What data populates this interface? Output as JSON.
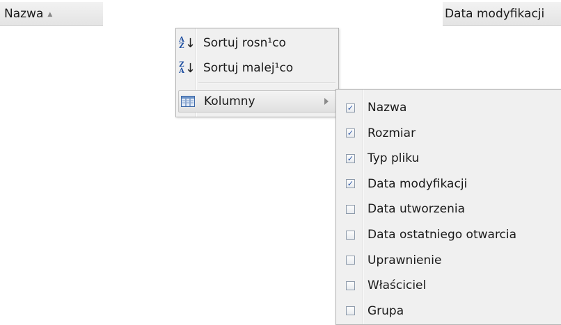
{
  "header": {
    "col_name": "Nazwa",
    "col_modified": "Data modyfikacji",
    "sort_indicator": "▲"
  },
  "menu": {
    "sort_asc": "Sortuj rosn¹co",
    "sort_desc": "Sortuj malej¹co",
    "columns": "Kolumny",
    "sort_asc_icon_top": "A",
    "sort_asc_icon_bottom": "Z",
    "sort_desc_icon_top": "Z",
    "sort_desc_icon_bottom": "A"
  },
  "columns_submenu": [
    {
      "label": "Nazwa",
      "checked": true
    },
    {
      "label": "Rozmiar",
      "checked": true
    },
    {
      "label": "Typ pliku",
      "checked": true
    },
    {
      "label": "Data modyfikacji",
      "checked": true
    },
    {
      "label": "Data utworzenia",
      "checked": false
    },
    {
      "label": "Data ostatniego otwarcia",
      "checked": false
    },
    {
      "label": "Uprawnienie",
      "checked": false
    },
    {
      "label": "Właściciel",
      "checked": false
    },
    {
      "label": "Grupa",
      "checked": false
    }
  ],
  "colors": {
    "check_mark": "#2a55a6",
    "menu_bg": "#f0f0f0",
    "icon_blue": "#1f4fa0"
  }
}
